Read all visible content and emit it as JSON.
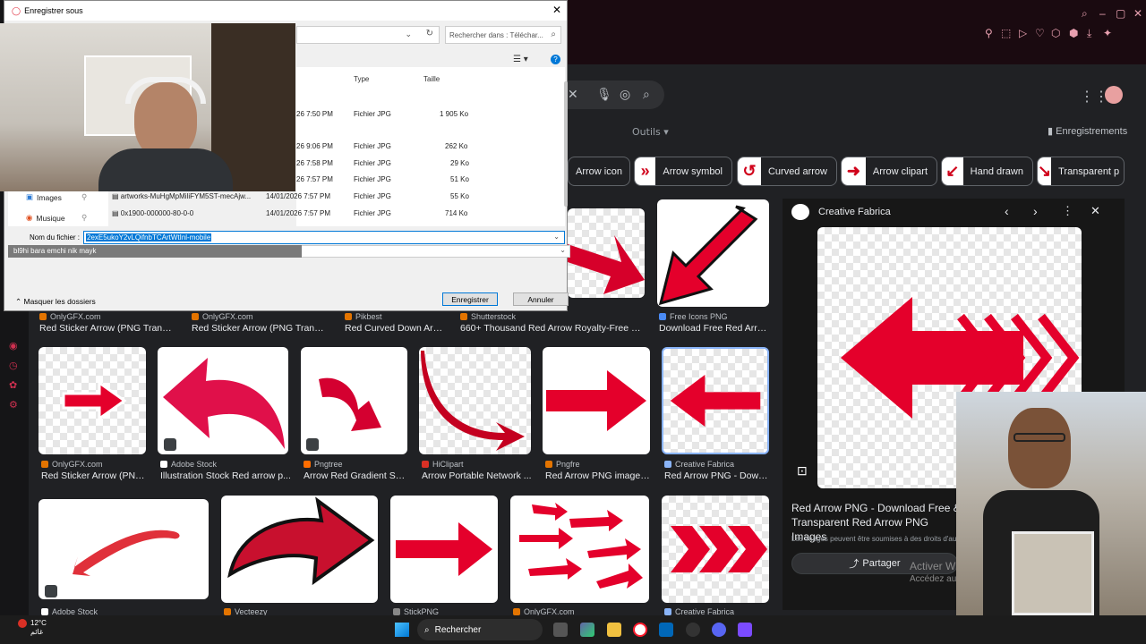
{
  "dialog": {
    "title": "Enregistrer sous",
    "search_placeholder": "Rechercher dans : Téléchar...",
    "headers": {
      "type": "Type",
      "size": "Taille"
    },
    "rows": [
      {
        "name": "",
        "date": "26 7:50 PM",
        "type": "Fichier JPG",
        "size": "1 905 Ko"
      },
      {
        "name": "",
        "date": "26 9:06 PM",
        "type": "Fichier JPG",
        "size": "262 Ko"
      },
      {
        "name": "",
        "date": "26 7:58 PM",
        "type": "Fichier JPG",
        "size": "29 Ko"
      },
      {
        "name": "",
        "date": "26 7:57 PM",
        "type": "Fichier JPG",
        "size": "51 Ko"
      },
      {
        "name": "artworks-MuHgMpMiliFYM5ST-mecAjw...",
        "date": "14/01/2026 7:57 PM",
        "type": "Fichier JPG",
        "size": "55 Ko"
      },
      {
        "name": "0x1900-000000-80-0-0",
        "date": "14/01/2026 7:57 PM",
        "type": "Fichier JPG",
        "size": "714 Ko"
      }
    ],
    "nav": [
      {
        "label": "Images"
      },
      {
        "label": "Musique"
      }
    ],
    "filename_label": "Nom du fichier :",
    "filename_value": "2exE5ukoY2vLQifnbTCArtWtInl-mobile",
    "type_overlay": "bl9hi bara emchi nik mayk",
    "hide_folders": "Masquer les dossiers",
    "save": "Enregistrer",
    "cancel": "Annuler"
  },
  "google": {
    "tools": "Outils",
    "saved": "Enregistrements",
    "chips": [
      "Arrow icon",
      "Arrow symbol",
      "Curved arrow",
      "Arrow clipart",
      "Hand drawn",
      "Transparent p"
    ],
    "row1": [
      {
        "source": "OnlyGFX.com",
        "title": "Red Sticker Arrow (PNG Transp..."
      },
      {
        "source": "OnlyGFX.com",
        "title": "Red Sticker Arrow (PNG Transpa..."
      },
      {
        "source": "Pikbest",
        "title": "Red Curved Down Arro..."
      },
      {
        "source": "Shutterstock",
        "title": "660+ Thousand Red Arrow Royalty-Free Ima..."
      },
      {
        "source": "Free Icons PNG",
        "title": "Download Free Red Arro..."
      }
    ],
    "row2": [
      {
        "source": "OnlyGFX.com",
        "title": "Red Sticker Arrow (PNG..."
      },
      {
        "source": "Adobe Stock",
        "title": "Illustration Stock Red arrow p..."
      },
      {
        "source": "Pngtree",
        "title": "Arrow Red Gradient Sha..."
      },
      {
        "source": "HiClipart",
        "title": "Arrow Portable Network ..."
      },
      {
        "source": "Pngfre",
        "title": "Red Arrow PNG images ..."
      },
      {
        "source": "Creative Fabrica",
        "title": "Red Arrow PNG - Downl..."
      }
    ],
    "row3": [
      {
        "source": "Adobe Stock"
      },
      {
        "source": "Vecteezy"
      },
      {
        "source": "StickPNG"
      },
      {
        "source": "OnlyGFX.com"
      },
      {
        "source": "Creative Fabrica"
      }
    ],
    "preview": {
      "source": "Creative Fabrica",
      "title": "Red Arrow PNG - Download Free & Transparent Red Arrow PNG Images",
      "note": "Les images peuvent être soumises à des droits d'auteur.",
      "share": "Partager"
    }
  },
  "watermark": {
    "line1": "Activer W",
    "line2": "Accédez au"
  },
  "taskbar": {
    "temp": "12°C",
    "weather_text": "غائم",
    "search": "Rechercher"
  },
  "colors": {
    "arrow_red": "#e4002b",
    "accent": "#0078d7"
  }
}
